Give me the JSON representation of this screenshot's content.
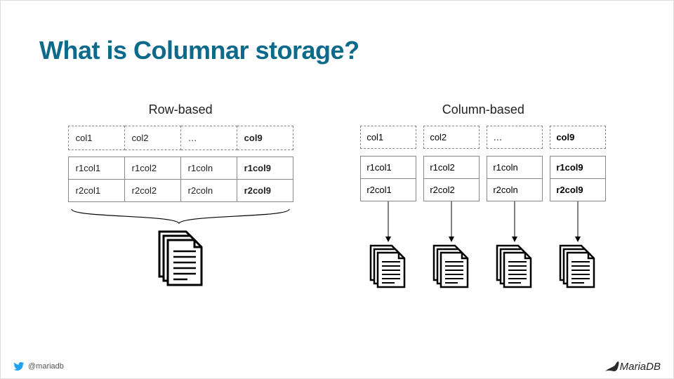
{
  "title": "What is Columnar storage?",
  "row_based": {
    "label": "Row-based",
    "headers": [
      "col1",
      "col2",
      "…",
      "col9"
    ],
    "rows": [
      [
        "r1col1",
        "r1col2",
        "r1coln",
        "r1col9"
      ],
      [
        "r2col1",
        "r2col2",
        "r2coln",
        "r2col9"
      ]
    ],
    "bold_col_index": 3
  },
  "column_based": {
    "label": "Column-based",
    "columns": [
      {
        "header": "col1",
        "cells": [
          "r1col1",
          "r2col1"
        ],
        "bold": false
      },
      {
        "header": "col2",
        "cells": [
          "r1col2",
          "r2col2"
        ],
        "bold": false
      },
      {
        "header": "…",
        "cells": [
          "r1coln",
          "r2coln"
        ],
        "bold": false
      },
      {
        "header": "col9",
        "cells": [
          "r1col9",
          "r2col9"
        ],
        "bold": true
      }
    ]
  },
  "footer": {
    "handle": "@mariadb",
    "brand": "MariaDB"
  }
}
